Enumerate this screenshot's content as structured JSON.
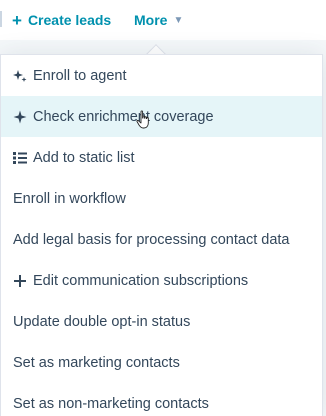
{
  "toolbar": {
    "create_label": "Create leads",
    "more_label": "More"
  },
  "menu": {
    "items": [
      {
        "label": "Enroll to agent",
        "icon": "sparkle-agent-icon"
      },
      {
        "label": "Check enrichment coverage",
        "icon": "sparkle-icon",
        "hover": true
      },
      {
        "label": "Add to static list",
        "icon": "list-icon"
      },
      {
        "label": "Enroll in workflow"
      },
      {
        "label": "Add legal basis for processing contact data"
      },
      {
        "label": "Edit communication subscriptions",
        "icon": "plus-icon"
      },
      {
        "label": "Update double opt-in status"
      },
      {
        "label": "Set as marketing contacts"
      },
      {
        "label": "Set as non-marketing contacts"
      }
    ]
  },
  "colors": {
    "accent": "#0091ae",
    "text": "#33475b",
    "hover_bg": "#e5f5f8"
  }
}
